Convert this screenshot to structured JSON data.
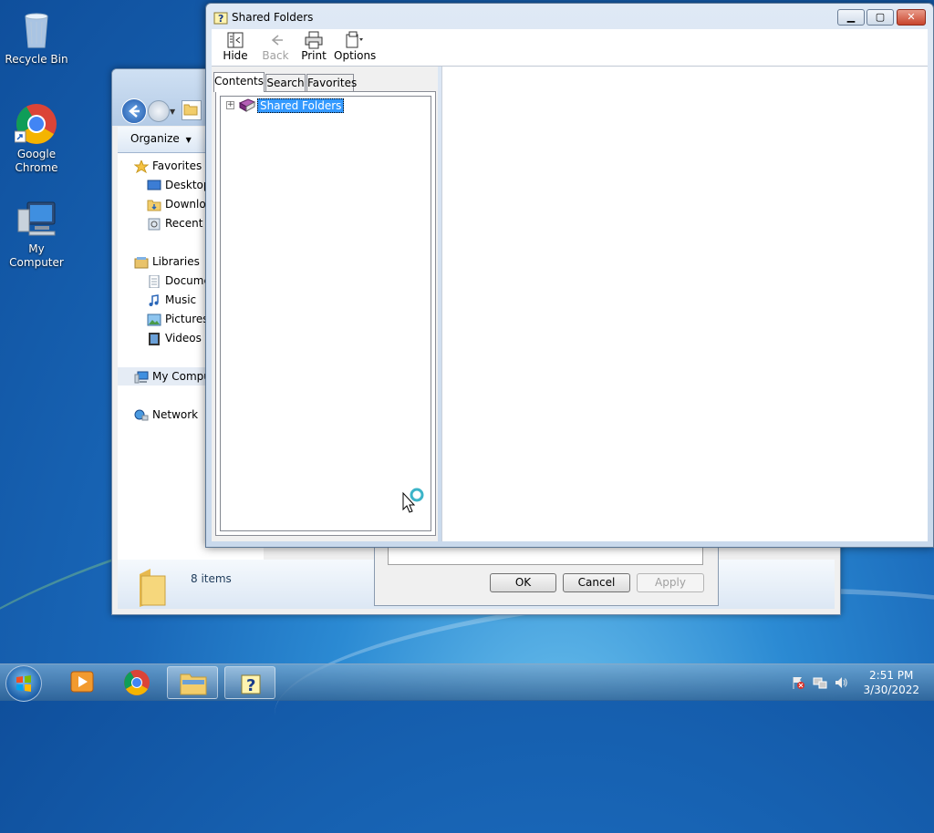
{
  "desktop": {
    "icons": [
      {
        "label": "Recycle Bin"
      },
      {
        "label": "Google Chrome"
      },
      {
        "label": "My Computer"
      }
    ]
  },
  "explorer": {
    "toolbar": {
      "organize_label": "Organize"
    },
    "nav": {
      "favorites": "Favorites",
      "desktop": "Desktop",
      "downloads": "Downloads",
      "recent": "Recent Places",
      "libraries": "Libraries",
      "documents": "Documents",
      "music": "Music",
      "pictures": "Pictures",
      "videos": "Videos",
      "computer": "My Computer",
      "network": "Network"
    },
    "status": {
      "items_count": "8 items"
    }
  },
  "properties_dialog": {
    "ok_label": "OK",
    "cancel_label": "Cancel",
    "apply_label": "Apply"
  },
  "help_window": {
    "title": "Shared Folders",
    "toolbar": {
      "hide": "Hide",
      "back": "Back",
      "print": "Print",
      "options": "Options"
    },
    "tabs": {
      "contents": "Contents",
      "search": "Search",
      "favorites": "Favorites"
    },
    "tree": {
      "root_label": "Shared Folders",
      "expander": "+"
    }
  },
  "taskbar": {
    "time": "2:51 PM",
    "date": "3/30/2022"
  },
  "colors": {
    "selection": "#3399ff",
    "close_button": "#c8452d"
  }
}
